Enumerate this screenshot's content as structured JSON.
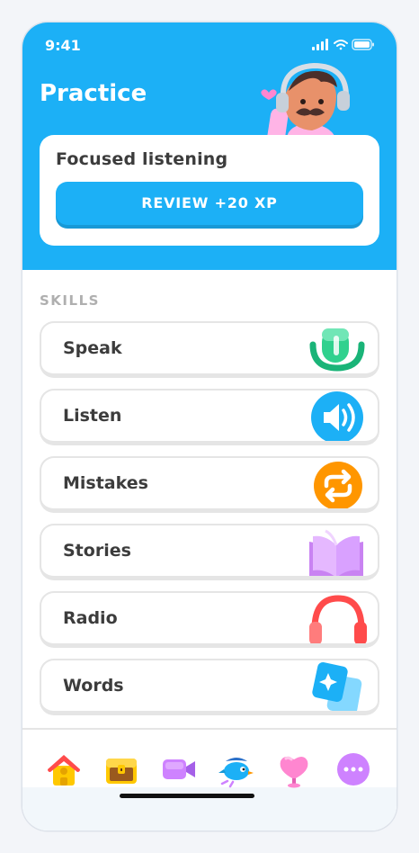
{
  "status_bar": {
    "time": "9:41"
  },
  "header": {
    "title": "Practice",
    "character_icon": "character-with-headset-icon"
  },
  "focus_card": {
    "title": "Focused listening",
    "button_label": "REVIEW +20 XP"
  },
  "skills": {
    "section_label": "SKILLS",
    "items": [
      {
        "label": "Speak",
        "icon": "microphone-icon"
      },
      {
        "label": "Listen",
        "icon": "speaker-icon"
      },
      {
        "label": "Mistakes",
        "icon": "repeat-icon"
      },
      {
        "label": "Stories",
        "icon": "book-icon"
      },
      {
        "label": "Radio",
        "icon": "headphones-icon"
      },
      {
        "label": "Words",
        "icon": "flashcard-icon"
      }
    ]
  },
  "bottom_nav": {
    "items": [
      {
        "icon": "home-icon"
      },
      {
        "icon": "treasure-chest-icon"
      },
      {
        "icon": "video-camera-icon"
      },
      {
        "icon": "bird-icon"
      },
      {
        "icon": "heart-icon"
      },
      {
        "icon": "more-icon"
      }
    ]
  },
  "colors": {
    "accent": "#1cb0f6",
    "accent_shadow": "#1899d6",
    "text": "#3c3c3c",
    "muted": "#afafaf",
    "border": "#e5e5e5"
  }
}
